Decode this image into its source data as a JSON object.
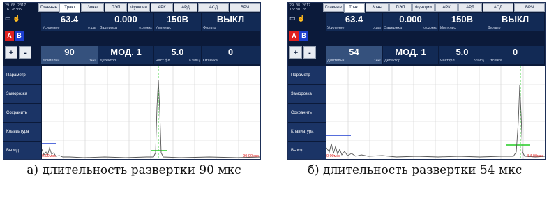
{
  "tabs": [
    "Главные",
    "Тракт",
    "Зоны",
    "ПЭП",
    "Функции",
    "АРК",
    "АРД",
    "АСД",
    "ВРЧ"
  ],
  "colors": {
    "screen": "#0b1a3a",
    "cell": "#122a55",
    "cell_highlight": "#35517d",
    "button_a": "#e0201f",
    "button_b": "#1e3fd0",
    "signal": "#555555",
    "gate_green": "#22cc22",
    "gate_blue": "#1e3fd0",
    "strobe_line": "#22cc22",
    "scale_labels": "#e0201f"
  },
  "params_row1": {
    "gain_value": "63.4",
    "gain_label": "Усиление",
    "gain_unit": "0.1дБ",
    "delay_value": "0.000",
    "delay_label": "Задержка",
    "delay_unit": "0.020мкс",
    "pulse_value": "150В",
    "pulse_label": "Импульс",
    "filter_value": "ВЫКЛ",
    "filter_label": "Фильтр"
  },
  "params_row2": {
    "duration_label": "Длительн.",
    "duration_unit": "1мкс",
    "detector_value": "МОД. 1",
    "detector_label": "Детектор",
    "frequency_value": "5.0",
    "frequency_label": "Част.фл.",
    "frequency_unit": "0.1МГц",
    "cutoff_value": "0",
    "cutoff_label": "Отсечка"
  },
  "buttons": {
    "a": "A",
    "b": "B",
    "plus": "+",
    "minus": "-"
  },
  "menu": [
    "Параметр",
    "Заморозка",
    "Сохранить",
    "Клавиатура",
    "Выход"
  ],
  "screens": [
    {
      "date": "29.08.2017",
      "time": "16:28:05",
      "duration_value": "90",
      "scale_start": "0.00мкс",
      "scale_end": "90.00мкс",
      "caption": "а) длительность развертки 90 мкс"
    },
    {
      "date": "29.08.2017",
      "time": "16:30:28",
      "duration_value": "54",
      "scale_start": "0.00мкс",
      "scale_end": "54.00мкс",
      "caption": "б) длительность развертки 54 мкс"
    }
  ]
}
